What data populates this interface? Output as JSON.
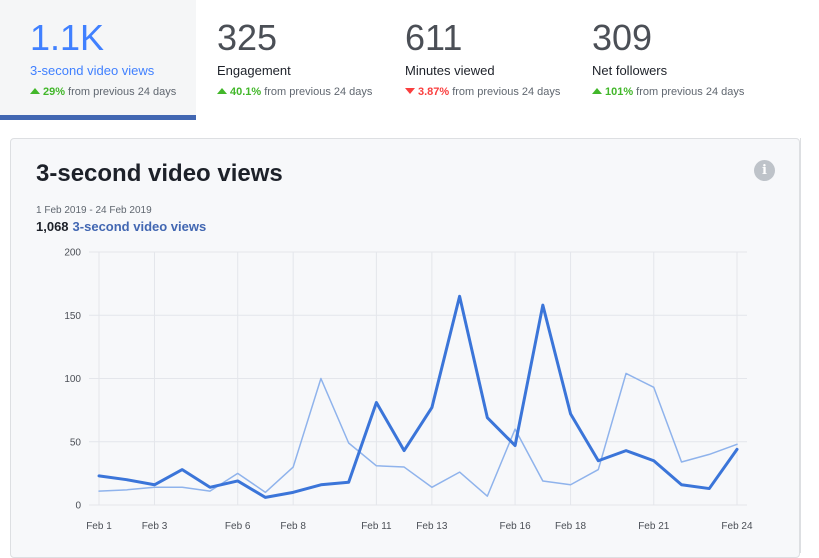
{
  "stats": [
    {
      "value": "1.1K",
      "label": "3-second video views",
      "change": "29%",
      "direction": "up",
      "suffix": "from previous 24 days"
    },
    {
      "value": "325",
      "label": "Engagement",
      "change": "40.1%",
      "direction": "up",
      "suffix": "from previous 24 days"
    },
    {
      "value": "611",
      "label": "Minutes viewed",
      "change": "3.87%",
      "direction": "down",
      "suffix": "from previous 24 days"
    },
    {
      "value": "309",
      "label": "Net followers",
      "change": "101%",
      "direction": "up",
      "suffix": "from previous 24 days"
    }
  ],
  "card": {
    "title": "3-second video views",
    "info_icon": "info-icon",
    "date_range": "1 Feb 2019 - 24 Feb 2019",
    "total_value": "1,068",
    "total_label": "3-second video views"
  },
  "colors": {
    "accent": "#4080ff",
    "primary_line": "#3b75d9",
    "secondary_line": "#8fb3ec",
    "up": "#42b72a",
    "down": "#fa3e3e"
  },
  "chart_data": {
    "type": "line",
    "x": [
      "Feb 1",
      "Feb 2",
      "Feb 3",
      "Feb 4",
      "Feb 5",
      "Feb 6",
      "Feb 7",
      "Feb 8",
      "Feb 9",
      "Feb 10",
      "Feb 11",
      "Feb 12",
      "Feb 13",
      "Feb 14",
      "Feb 15",
      "Feb 16",
      "Feb 17",
      "Feb 18",
      "Feb 19",
      "Feb 20",
      "Feb 21",
      "Feb 22",
      "Feb 23",
      "Feb 24"
    ],
    "tick_labels": [
      "Feb 1",
      "Feb 3",
      "Feb 6",
      "Feb 8",
      "Feb 11",
      "Feb 13",
      "Feb 16",
      "Feb 18",
      "Feb 21",
      "Feb 24"
    ],
    "tick_indices": [
      0,
      2,
      5,
      7,
      10,
      12,
      15,
      17,
      20,
      23
    ],
    "ylim": [
      0,
      200
    ],
    "yticks": [
      0,
      50,
      100,
      150,
      200
    ],
    "grid": true,
    "series": [
      {
        "values": [
          23,
          20,
          16,
          28,
          14,
          19,
          6,
          10,
          16,
          18,
          81,
          43,
          77,
          165,
          69,
          47,
          158,
          72,
          35,
          43,
          35,
          16,
          13,
          44
        ],
        "style": "primary"
      },
      {
        "values": [
          11,
          12,
          14,
          14,
          11,
          25,
          10,
          30,
          100,
          49,
          31,
          30,
          14,
          26,
          7,
          60,
          19,
          16,
          28,
          104,
          93,
          34,
          40,
          48
        ],
        "style": "secondary"
      }
    ]
  }
}
